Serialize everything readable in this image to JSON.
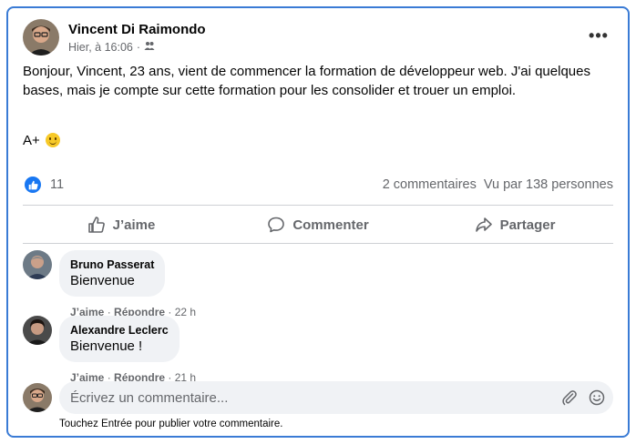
{
  "post": {
    "author": "Vincent Di Raimondo",
    "timestamp": "Hier, à 16:06",
    "separator": "·",
    "audience_icon": "friends-icon",
    "text_line": "Bonjour, Vincent, 23 ans, vient de commencer la formation de développeur web. J'ai quelques bases, mais je compte sur cette formation pour les consolider et trouer un emploi.",
    "text_signoff": "A+",
    "more_label": "•••"
  },
  "stats": {
    "like_count": "11",
    "comments": "2 commentaires",
    "views": "Vu par 138 personnes"
  },
  "actions": {
    "like": "J’aime",
    "comment": "Commenter",
    "share": "Partager"
  },
  "comments": [
    {
      "author": "Bruno Passerat",
      "text": "Bienvenue",
      "like": "J’aime",
      "dot": "·",
      "reply": "Répondre",
      "time": "22 h"
    },
    {
      "author": "Alexandre Leclerc",
      "text": "Bienvenue !",
      "like": "J’aime",
      "dot": "·",
      "reply": "Répondre",
      "time": "21 h"
    }
  ],
  "composer": {
    "placeholder": "Écrivez un commentaire...",
    "hint": "Touchez Entrée pour publier votre commentaire."
  },
  "colors": {
    "accent": "#1877f2",
    "border": "#3a7bd5",
    "muted_text": "#65676b",
    "bubble_bg": "#f0f2f5"
  }
}
